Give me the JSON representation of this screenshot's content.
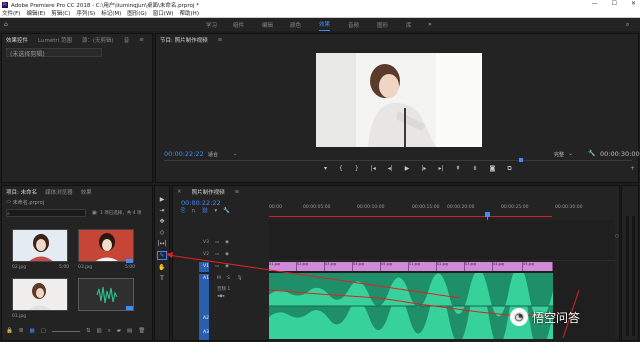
{
  "window": {
    "title": "Adobe Premiere Pro CC 2018 - C:\\用户\\liuminqjun\\桌面\\未命名.prproj *",
    "controls": [
      "—",
      "☐",
      "✕"
    ]
  },
  "menu": [
    "文件(F)",
    "编辑(E)",
    "剪辑(C)",
    "序列(S)",
    "标记(M)",
    "图形(G)",
    "窗口(W)",
    "帮助(H)"
  ],
  "workspaces": [
    "学习",
    "组件",
    "编辑",
    "颜色",
    "效果",
    "音频",
    "图形",
    "库"
  ],
  "active_workspace": "效果",
  "source_panel": {
    "tabs": [
      "效果控件",
      "Lumetri 范围",
      "源：(无剪辑)",
      "音"
    ],
    "active_tab": "效果控件",
    "subtitle": "(未选择剪辑)"
  },
  "program_panel": {
    "title": "节目: 照片制作视频",
    "timecode": "00:00:22:22",
    "fit": "适合",
    "quality": "完整",
    "duration": "00:00:30:00"
  },
  "project_panel": {
    "tabs": [
      "项目: 未命名",
      "媒体浏览器",
      "效果"
    ],
    "project_file": "未命名.prproj",
    "count_label": "1 项已选择，共 4 项",
    "thumbs": [
      {
        "name": "02.jpg",
        "duration": "5:00"
      },
      {
        "name": "03.jpg",
        "duration": "5:00"
      },
      {
        "name": "01.jpg",
        "duration": ""
      },
      {
        "name": "",
        "duration": ""
      }
    ]
  },
  "timeline": {
    "title": "照片制作视频",
    "timecode": "00:00:22:22",
    "ruler": [
      "00:00",
      "00:00:05:00",
      "00:00:10:00",
      "00:00:15:00",
      "00:00:20:00",
      "00:00:25:00",
      "00:00:30:00"
    ],
    "tracks": {
      "v3": "V3",
      "v2": "V2",
      "v1": "V1",
      "a1": "A1",
      "a2": "A2",
      "a3": "A3",
      "a1_name": "音频 1"
    },
    "clips": [
      "01.jpg",
      "02.jpg",
      "03.jpg",
      "04.jpg",
      "05.jpg",
      "01.jpg",
      "02.jpg",
      "03.jpg",
      "04.jpg",
      "05.jpg"
    ]
  },
  "tools": [
    "▶",
    "⇥",
    "✥",
    "◇",
    "|↔|",
    "✎",
    "✋",
    "T"
  ],
  "watermark": "悟空问答",
  "colors": {
    "accent": "#3f8cff",
    "clip": "#d18ad8",
    "audio": "#2fb88a",
    "annotation": "#e02020"
  }
}
